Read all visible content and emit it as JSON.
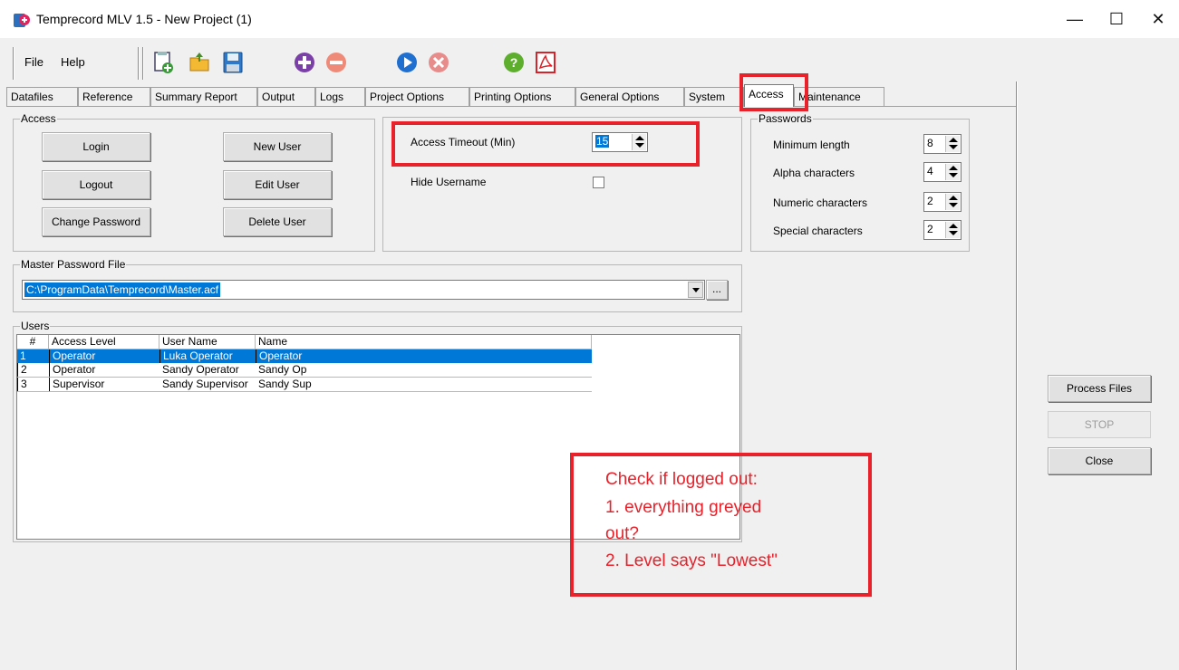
{
  "window": {
    "title": "Temprecord MLV 1.5 - New Project (1)",
    "controls": {
      "minimize": "—",
      "maximize": "☐",
      "close": "✕"
    }
  },
  "menu": {
    "file": "File",
    "help": "Help"
  },
  "toolbar_icons": [
    "new-project-icon",
    "open-folder-icon",
    "save-icon",
    "add-icon",
    "remove-icon",
    "play-icon",
    "cancel-icon",
    "help-icon",
    "pdf-icon"
  ],
  "tabs": [
    {
      "label": "Datafiles"
    },
    {
      "label": "Reference"
    },
    {
      "label": "Summary Report"
    },
    {
      "label": "Output"
    },
    {
      "label": "Logs"
    },
    {
      "label": "Project Options"
    },
    {
      "label": "Printing Options"
    },
    {
      "label": "General Options"
    },
    {
      "label": "System"
    },
    {
      "label": "Access"
    },
    {
      "label": "Maintenance"
    }
  ],
  "active_tab": "Access",
  "access_group": {
    "label": "Access",
    "buttons": {
      "login": "Login",
      "logout": "Logout",
      "change_password": "Change Password",
      "new_user": "New User",
      "edit_user": "Edit User",
      "delete_user": "Delete User"
    }
  },
  "timeout": {
    "label": "Access Timeout (Min)",
    "value": "15",
    "hide_username_label": "Hide Username",
    "hide_username_checked": false
  },
  "passwords": {
    "label": "Passwords",
    "fields": [
      {
        "label": "Minimum length",
        "value": "8"
      },
      {
        "label": "Alpha characters",
        "value": "4"
      },
      {
        "label": "Numeric characters",
        "value": "2"
      },
      {
        "label": "Special characters",
        "value": "2"
      }
    ]
  },
  "master_password": {
    "label": "Master Password File",
    "path": "C:\\ProgramData\\Temprecord\\Master.acf",
    "browse_label": "..."
  },
  "users": {
    "label": "Users",
    "columns": [
      "#",
      "Access Level",
      "User Name",
      "Name"
    ],
    "rows": [
      {
        "num": "1",
        "level": "Operator",
        "username": "Luka Operator",
        "name": "Operator",
        "selected": true
      },
      {
        "num": "2",
        "level": "Operator",
        "username": "Sandy Operator",
        "name": "Sandy Op",
        "selected": false
      },
      {
        "num": "3",
        "level": "Supervisor",
        "username": "Sandy Supervisor",
        "name": "Sandy Sup",
        "selected": false
      }
    ]
  },
  "side_buttons": {
    "process_files": "Process Files",
    "stop": "STOP",
    "close": "Close"
  },
  "annotation": {
    "color": "#e8212a",
    "lines": [
      "Check if logged out:",
      "1. everything greyed",
      "out?",
      "2. Level says \"Lowest\""
    ]
  }
}
